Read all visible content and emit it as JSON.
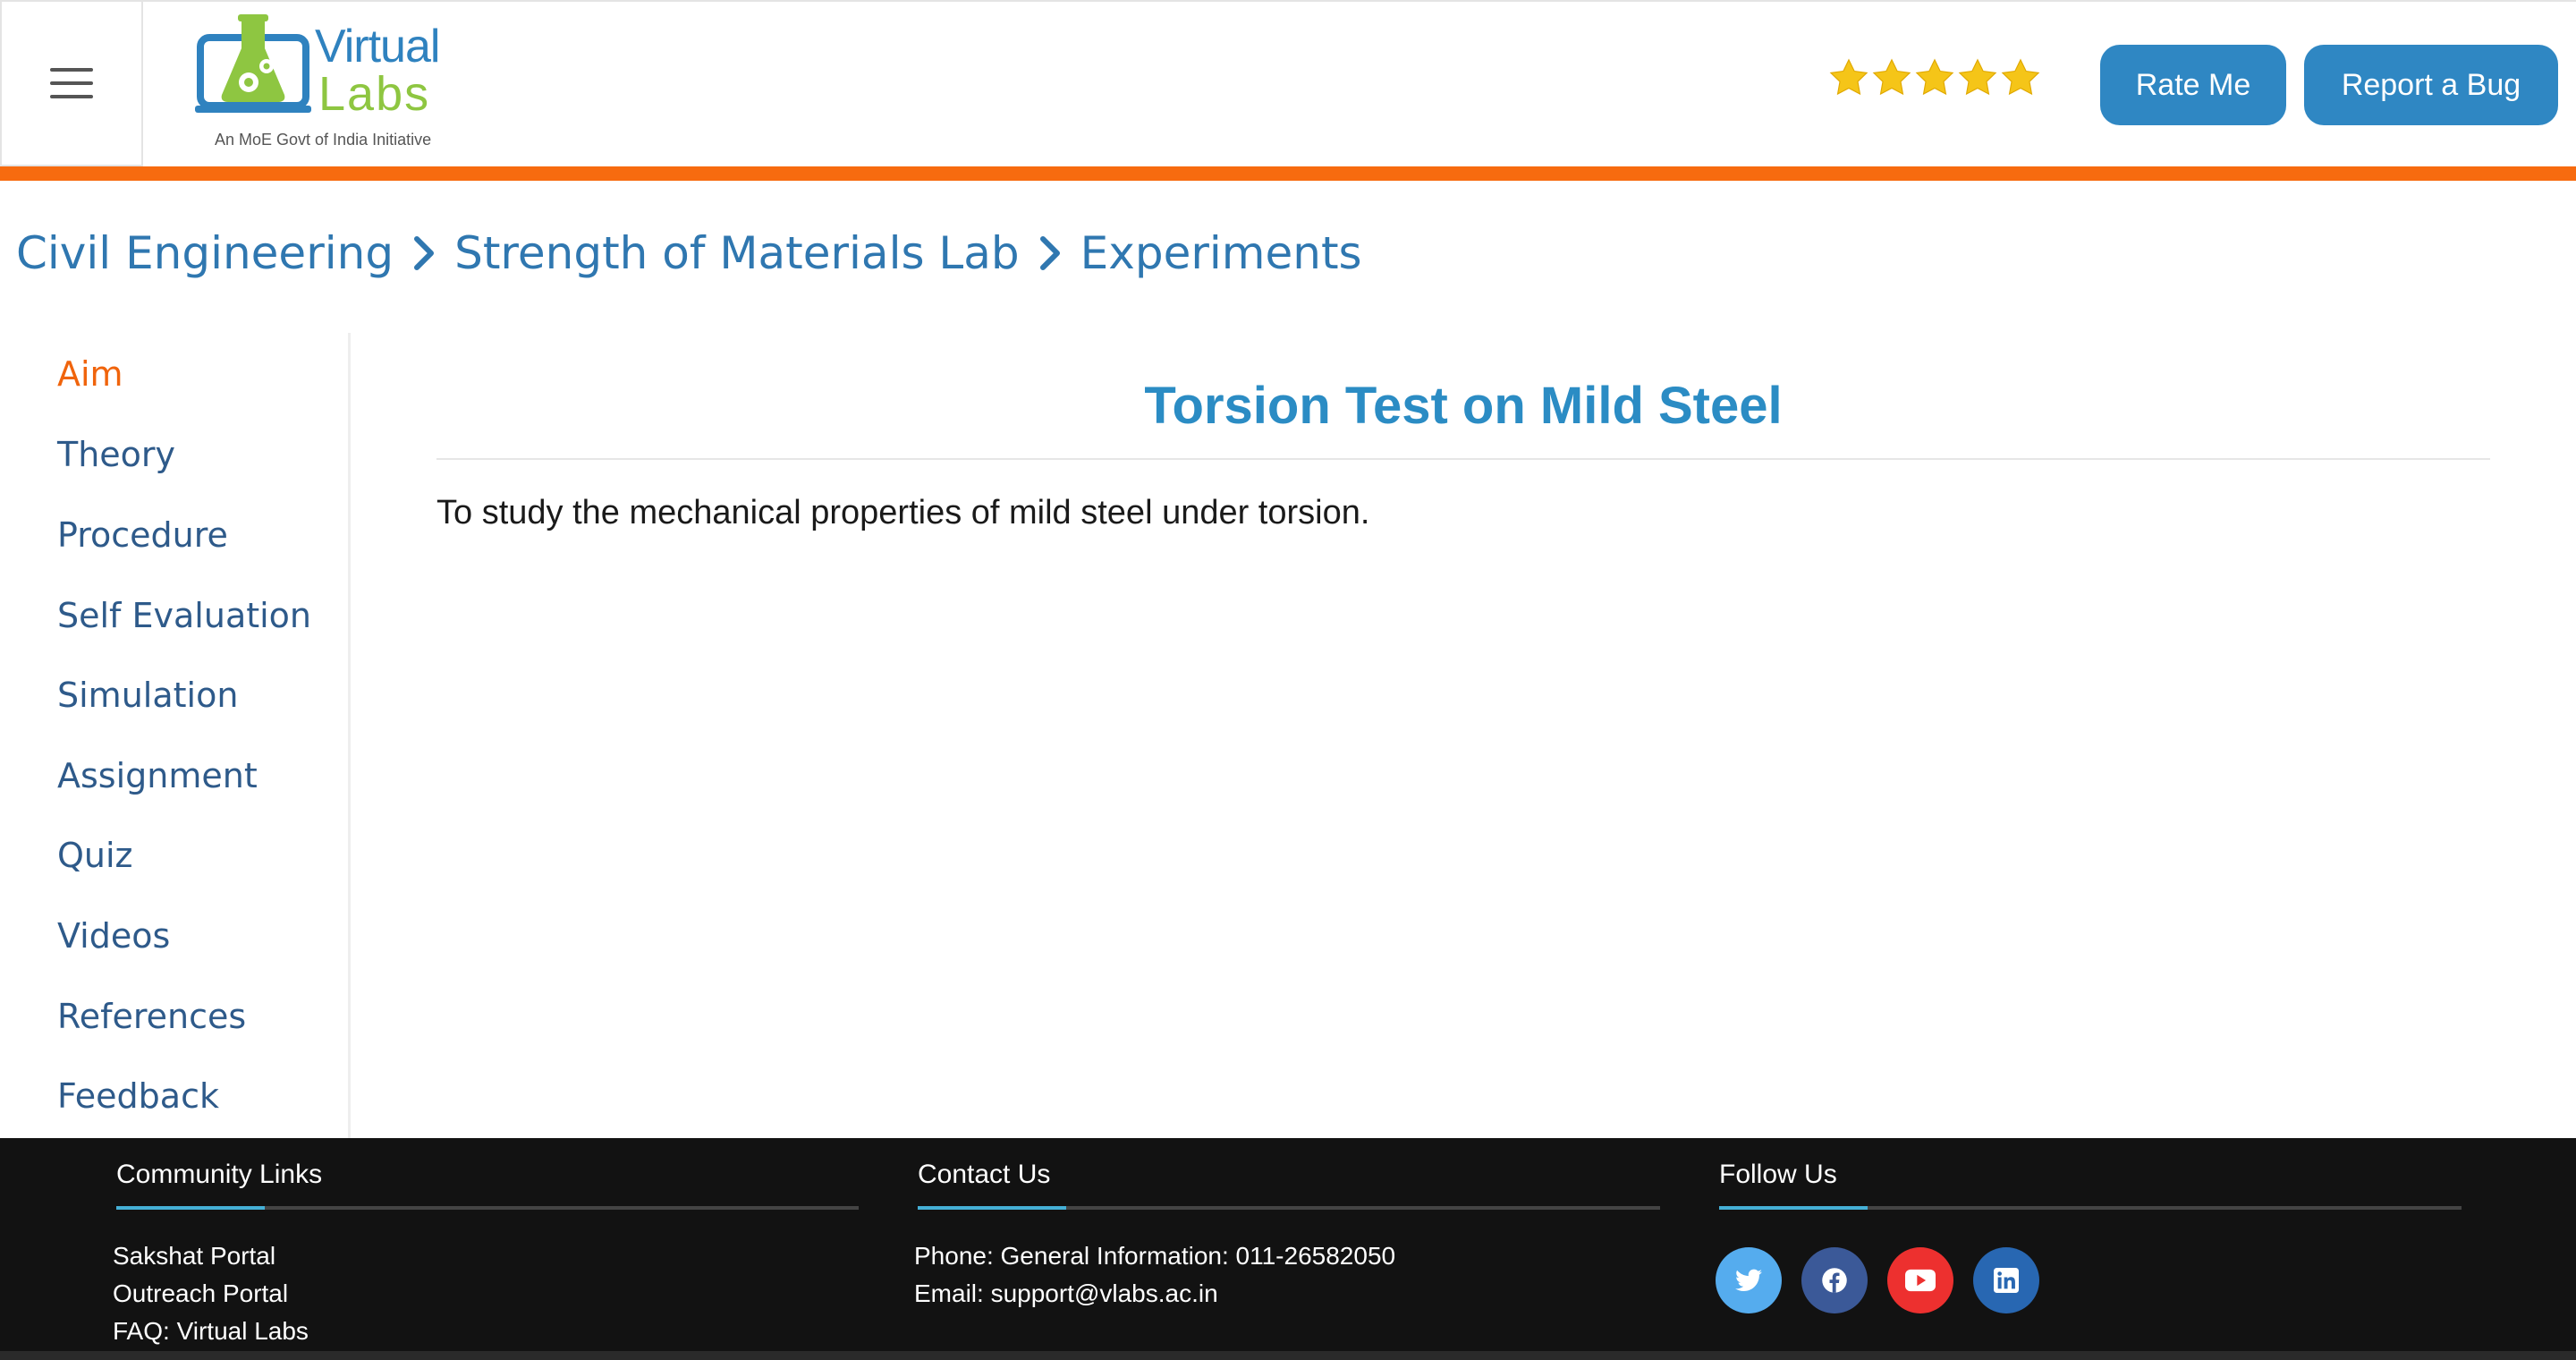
{
  "header": {
    "menu_icon": "hamburger-icon",
    "logo": {
      "word1": "Virtual",
      "word2": "Labs",
      "tagline": "An MoE Govt of India Initiative"
    },
    "rating": {
      "stars": 5,
      "max": 5,
      "color": "#f5c518"
    },
    "rate_button": "Rate Me",
    "bug_button": "Report a Bug"
  },
  "breadcrumb": {
    "items": [
      "Civil Engineering",
      "Strength of Materials Lab",
      "Experiments"
    ],
    "separator_icon": "chevron-right-icon"
  },
  "sidebar": {
    "items": [
      {
        "label": "Aim",
        "active": true
      },
      {
        "label": "Theory"
      },
      {
        "label": "Procedure"
      },
      {
        "label": "Self Evaluation"
      },
      {
        "label": "Simulation"
      },
      {
        "label": "Assignment"
      },
      {
        "label": "Quiz"
      },
      {
        "label": "Videos"
      },
      {
        "label": "References"
      },
      {
        "label": "Feedback"
      }
    ]
  },
  "main": {
    "title": "Torsion Test on Mild Steel",
    "aim_text": "To study the mechanical properties of mild steel under torsion."
  },
  "footer": {
    "community": {
      "heading": "Community Links",
      "links": [
        "Sakshat Portal",
        "Outreach Portal",
        "FAQ: Virtual Labs"
      ]
    },
    "contact": {
      "heading": "Contact Us",
      "phone": "Phone: General Information: 011-26582050",
      "email": "Email: support@vlabs.ac.in"
    },
    "follow": {
      "heading": "Follow Us",
      "icons": [
        {
          "name": "twitter-icon",
          "color": "#55acee"
        },
        {
          "name": "facebook-icon",
          "color": "#3b5998"
        },
        {
          "name": "youtube-icon",
          "color": "#ed302f"
        },
        {
          "name": "linkedin-icon",
          "color": "#0077b5"
        }
      ]
    }
  },
  "colors": {
    "accent_orange": "#f76b0f",
    "button_blue": "#2f87c3",
    "title_blue": "#2b8cc4",
    "breadcrumb_blue": "#2f77b0",
    "sidebar_text": "#2e5a8a",
    "footer_bg": "#121212",
    "footer_accent": "#45b0d6"
  }
}
